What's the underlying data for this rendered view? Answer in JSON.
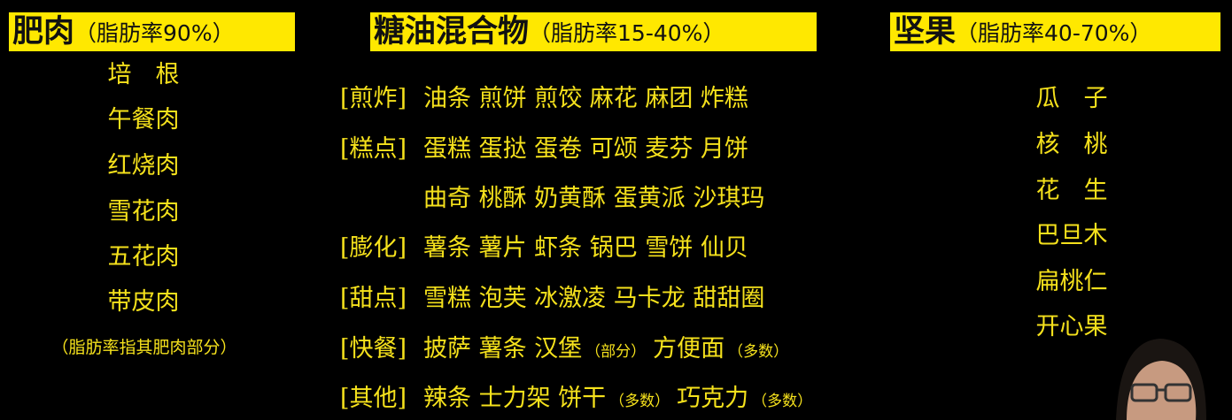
{
  "columns": {
    "fat_meat": {
      "title": "肥肉",
      "subtitle": "（脂肪率90%）",
      "items": [
        "培　根",
        "午餐肉",
        "红烧肉",
        "雪花肉",
        "五花肉",
        "带皮肉"
      ],
      "note": "（脂肪率指其肥肉部分）"
    },
    "sugar_oil": {
      "title": "糖油混合物",
      "subtitle": "（脂肪率15-40%）",
      "rows": [
        {
          "label": "[煎炸]",
          "text": "油条 煎饼 煎饺 麻花 麻团 炸糕"
        },
        {
          "label": "[糕点]",
          "text": "蛋糕 蛋挞 蛋卷 可颂 麦芬 月饼"
        },
        {
          "label": "",
          "text": "曲奇 桃酥 奶黄酥 蛋黄派 沙琪玛"
        },
        {
          "label": "[膨化]",
          "text": "薯条 薯片 虾条 锅巴 雪饼 仙贝"
        },
        {
          "label": "[甜点]",
          "text": "雪糕 泡芙 冰激凌 马卡龙 甜甜圈"
        },
        {
          "label": "[快餐]",
          "text": "披萨 薯条 汉堡",
          "sub": "（部分）",
          "text2": "方便面",
          "sub2": "（多数）"
        },
        {
          "label": "[其他]",
          "text": "辣条 士力架 饼干",
          "sub": "（多数）",
          "text2": "巧克力",
          "sub2": "（多数）"
        }
      ]
    },
    "nuts": {
      "title": "坚果",
      "subtitle": "（脂肪率40-70%）",
      "items": [
        "瓜　子",
        "核　桃",
        "花　生",
        "巴旦木",
        "扁桃仁",
        "开心果"
      ]
    }
  },
  "colors": {
    "highlight": "#ffe800",
    "text": "#f5e11c",
    "background": "#000000"
  }
}
